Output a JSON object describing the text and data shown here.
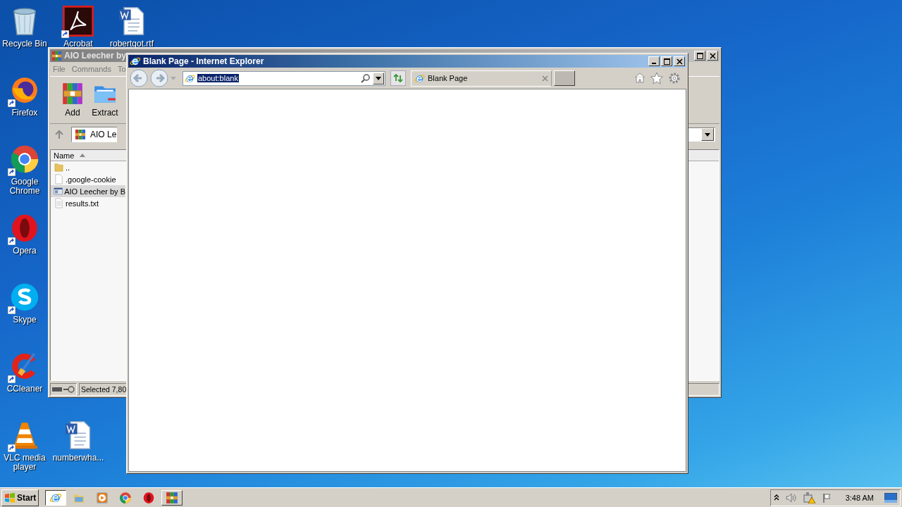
{
  "desktop_icons": [
    {
      "label": "Recycle Bin",
      "kind": "recycle",
      "shortcut": false
    },
    {
      "label": "Acrobat",
      "kind": "acrobat",
      "shortcut": true
    },
    {
      "label": "robertgot.rtf",
      "kind": "word",
      "shortcut": false
    },
    {
      "label": "Firefox",
      "kind": "firefox",
      "shortcut": true
    },
    {
      "label": "Google Chrome",
      "kind": "chrome",
      "shortcut": true
    },
    {
      "label": "Opera",
      "kind": "opera",
      "shortcut": true
    },
    {
      "label": "Skype",
      "kind": "skype",
      "shortcut": true
    },
    {
      "label": "CCleaner",
      "kind": "ccleaner",
      "shortcut": true
    },
    {
      "label": "VLC media player",
      "kind": "vlc",
      "shortcut": true
    },
    {
      "label": "numberwha...",
      "kind": "word",
      "shortcut": false
    }
  ],
  "archive_window": {
    "title": "AIO Leecher by",
    "menu": [
      "File",
      "Commands",
      "To"
    ],
    "toolbar": [
      {
        "label": "Add",
        "kind": "add"
      },
      {
        "label": "Extract",
        "kind": "extract"
      }
    ],
    "address": "AIO Le",
    "columns": [
      "Name"
    ],
    "files": [
      {
        "name": "..",
        "kind": "folder",
        "selected": false
      },
      {
        "name": ".google-cookie",
        "kind": "file",
        "selected": false
      },
      {
        "name": "AIO Leecher by B",
        "kind": "exe",
        "selected": true
      },
      {
        "name": "results.txt",
        "kind": "text",
        "selected": false
      }
    ],
    "status": "Selected 7,80"
  },
  "browser": {
    "title": "Blank Page - Internet Explorer",
    "address": "about:blank",
    "tab": "Blank Page"
  },
  "taskbar": {
    "start": "Start",
    "buttons": [
      {
        "kind": "ie",
        "selected": true
      },
      {
        "kind": "explorer",
        "selected": false
      },
      {
        "kind": "media",
        "selected": false
      },
      {
        "kind": "chrome",
        "selected": false
      },
      {
        "kind": "opera",
        "selected": false
      },
      {
        "kind": "winrar",
        "selected": false
      }
    ],
    "clock": "3:48 AM"
  }
}
